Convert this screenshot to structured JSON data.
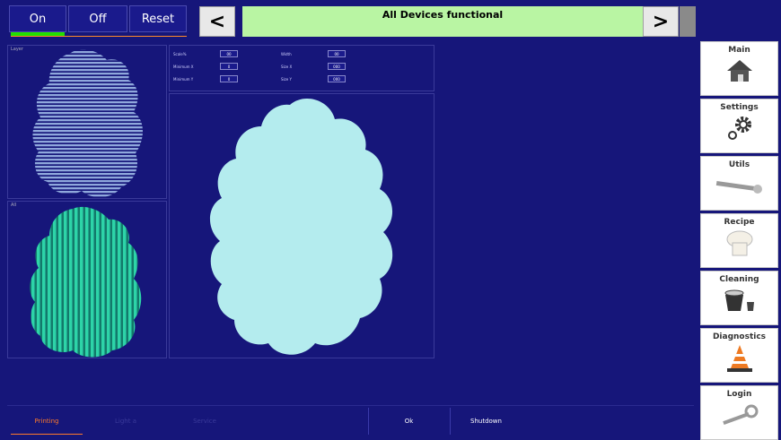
{
  "top": {
    "on_label": "On",
    "off_label": "Off",
    "reset_label": "Reset",
    "prev_label": "<",
    "next_label": ">",
    "status_text": "All Devices functional",
    "status_color": "#b9f5a3",
    "on_indicator_color": "#22e000"
  },
  "sidebar": {
    "items": [
      {
        "label": "Main",
        "icon": "house-icon"
      },
      {
        "label": "Settings",
        "icon": "gears-icon"
      },
      {
        "label": "Utils",
        "icon": "wrench-icon"
      },
      {
        "label": "Recipe",
        "icon": "chef-hat-icon"
      },
      {
        "label": "Cleaning",
        "icon": "bucket-icon"
      },
      {
        "label": "Diagnostics",
        "icon": "traffic-cone-icon"
      },
      {
        "label": "Login",
        "icon": "key-icon"
      }
    ]
  },
  "params": {
    "row1": [
      {
        "label": "Scale%",
        "value": "00"
      },
      {
        "label": "Width",
        "value": "00"
      }
    ],
    "row2": [
      {
        "label": "Minimum X",
        "value": "0"
      },
      {
        "label": "Size X",
        "value": "000"
      }
    ],
    "row3": [
      {
        "label": "Minimum Y",
        "value": "0"
      },
      {
        "label": "Size Y",
        "value": "000"
      }
    ]
  },
  "panels": {
    "top_left_label": "Layer",
    "bottom_left_label": "All"
  },
  "bottom": {
    "tabs": [
      "Printing",
      "Light a",
      "Service",
      "Ok",
      "Shutdown"
    ]
  },
  "colors": {
    "background": "#16167a",
    "main_shape": "#b4ecee",
    "green_shape": "#2dd4a8",
    "stripe_shape": "#8fa8dc"
  }
}
